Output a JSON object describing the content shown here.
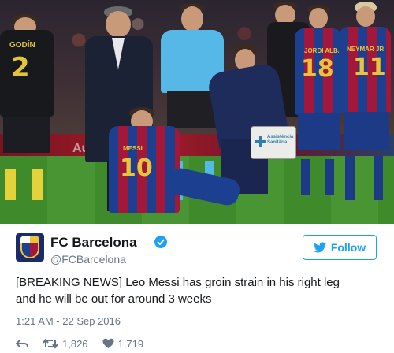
{
  "photo": {
    "jersey_names": {
      "godin": "GODÍN",
      "left_teammate": "JORDI ALBA",
      "right_teammate": "NEYMAR JR",
      "messi": "MESSI"
    },
    "jersey_numbers": {
      "godin": "2",
      "left_teammate": "18",
      "right_teammate": "11",
      "messi": "10"
    },
    "medical_bag_text": "Assistència Sanitària",
    "ad_board_text": "Audi"
  },
  "tweet": {
    "account_name": "FC Barcelona",
    "handle": "@FCBarcelona",
    "verified": true,
    "follow_label": "Follow",
    "text_line1": "[BREAKING NEWS] Leo Messi has groin strain in his right leg",
    "text_line2": "and he will be out for around 3 weeks",
    "timestamp": "1:21 AM - 22 Sep 2016",
    "retweets": "1,826",
    "likes": "1,719"
  },
  "colors": {
    "twitter_blue": "#1da1f2",
    "secondary_text": "#657786",
    "barca_blue": "#1c3f8f",
    "barca_red": "#a3173a"
  },
  "icons": {
    "reply": "reply-arrow-icon",
    "retweet": "retweet-icon",
    "like": "heart-icon",
    "verified": "verified-badge-icon",
    "follow": "twitter-bird-icon"
  }
}
